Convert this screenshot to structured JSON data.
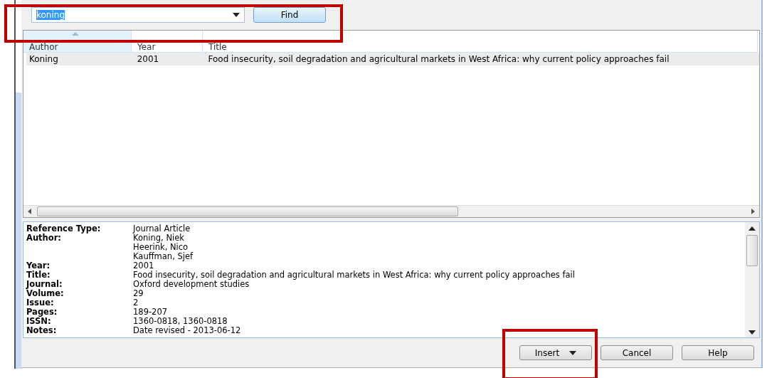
{
  "search": {
    "value": "koning",
    "highlighted": true,
    "button": "Find"
  },
  "table": {
    "columns": [
      {
        "label": "Author",
        "sorted": true
      },
      {
        "label": "Year",
        "sorted": false
      },
      {
        "label": "Title",
        "sorted": false
      }
    ],
    "rows": [
      {
        "selected": true,
        "cells": [
          "Koning",
          "2001",
          "Food insecurity, soil degradation and agricultural markets in West Africa: why current policy approaches fail"
        ]
      }
    ]
  },
  "details": [
    {
      "label": "Reference Type:",
      "values": [
        "Journal Article"
      ]
    },
    {
      "label": "Author:",
      "values": [
        "Koning, Niek",
        "Heerink, Nico",
        "Kauffman, Sjef"
      ]
    },
    {
      "label": "Year:",
      "values": [
        "2001"
      ]
    },
    {
      "label": "Title:",
      "values": [
        "Food insecurity, soil degradation and agricultural markets in West Africa: why current policy approaches fail"
      ]
    },
    {
      "label": "Journal:",
      "values": [
        "Oxford development studies"
      ]
    },
    {
      "label": "Volume:",
      "values": [
        "29"
      ]
    },
    {
      "label": "Issue:",
      "values": [
        "2"
      ]
    },
    {
      "label": "Pages:",
      "values": [
        "189-207"
      ]
    },
    {
      "label": "ISSN:",
      "values": [
        "1360-0818, 1360-0818"
      ]
    },
    {
      "label": "Notes:",
      "values": [
        "Date revised - 2013-06-12"
      ]
    }
  ],
  "buttons": [
    {
      "label": "Insert",
      "kind": "split"
    },
    {
      "label": "Cancel",
      "kind": "plain"
    },
    {
      "label": "Help",
      "kind": "plain"
    }
  ]
}
